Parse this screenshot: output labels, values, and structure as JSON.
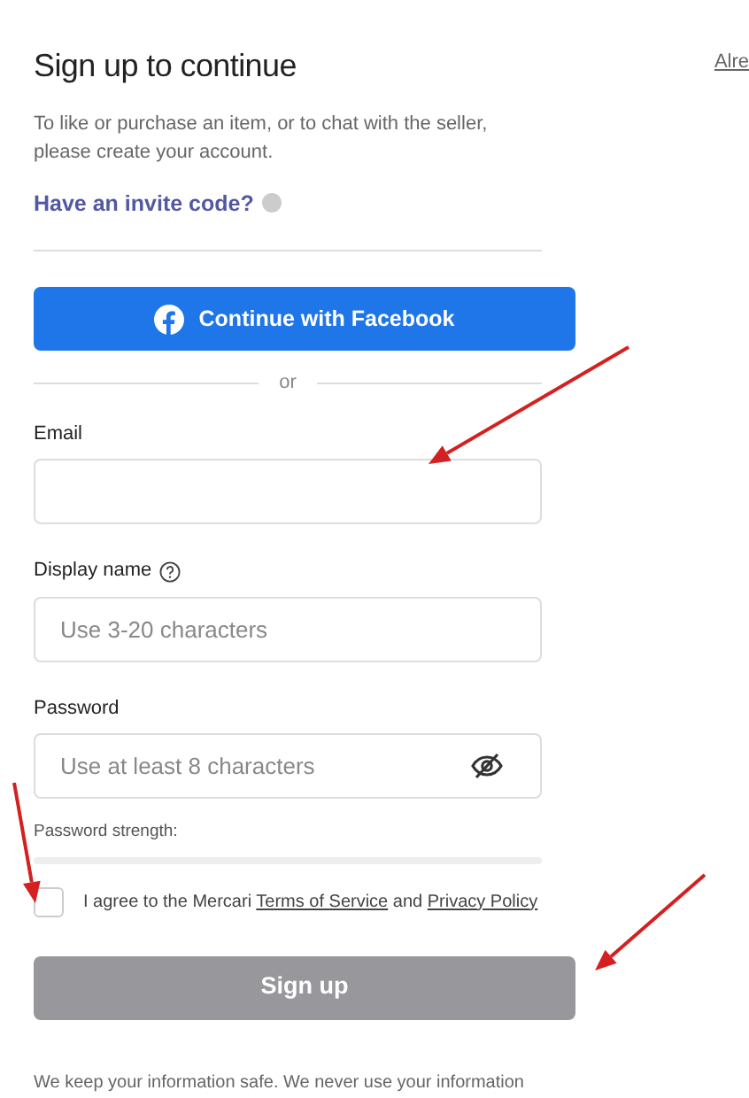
{
  "header_link": "Alre",
  "title": "Sign up to continue",
  "subtitle": "To like or purchase an item, or to chat with the seller, please create your account.",
  "invite_link": "Have an invite code?",
  "facebook_button": "Continue with Facebook",
  "divider_text": "or",
  "fields": [
    {
      "label": "Email",
      "help": false,
      "kind": "text"
    },
    {
      "label": "Display name",
      "placeholder": "Use 3-20 characters",
      "help": true,
      "kind": "text"
    },
    {
      "label": "Password",
      "placeholder": "Use at least 8 characters",
      "help": false,
      "kind": "password"
    }
  ],
  "password_strength": {
    "label": "Password strength:"
  },
  "agreement": {
    "checked": false,
    "text": "I agree to the Mercari ",
    "terms_link": "Terms of Service",
    "and_text": "and",
    "privacy_link": "Privacy Policy"
  },
  "signup_button": {
    "label": "Sign up",
    "disabled": true
  },
  "footer_text": "We keep your information safe. We never use your information",
  "annotation_arrows": [
    {
      "kind": "arrow"
    },
    {
      "kind": "arrow"
    },
    {
      "kind": "arrow"
    }
  ]
}
